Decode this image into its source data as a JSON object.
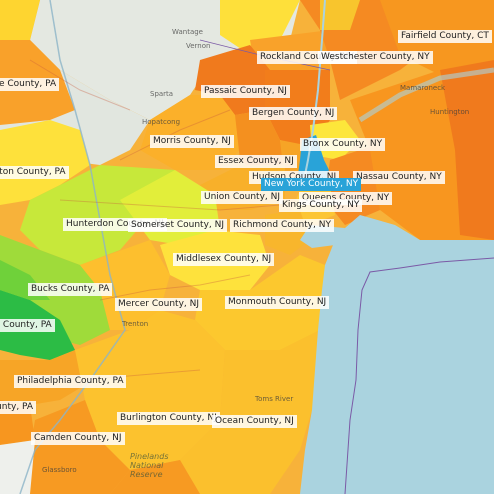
{
  "map": {
    "colors": {
      "water": "#aad3df",
      "land": "#e9ebe7",
      "selected": "#29a3d8",
      "scale": [
        "#1fb84a",
        "#6fd13a",
        "#bde83a",
        "#fffb3c",
        "#fdd12e",
        "#fcb52a",
        "#f79a22",
        "#f27a1e",
        "#ee5a18"
      ]
    },
    "counties": [
      {
        "label": "Fairfield County, CT"
      },
      {
        "label": "Rockland County, NY"
      },
      {
        "label": "Westchester County, NY"
      },
      {
        "label": "Monroe County, PA"
      },
      {
        "label": "Passaic County, NJ"
      },
      {
        "label": "Bergen County, NJ"
      },
      {
        "label": "Morris County, NJ"
      },
      {
        "label": "Bronx County, NY"
      },
      {
        "label": "Essex County, NJ"
      },
      {
        "label": "Northampton County, PA"
      },
      {
        "label": "Hudson County, NJ"
      },
      {
        "label": "Nassau County, NY"
      },
      {
        "label": "New York County, NY",
        "selected": true
      },
      {
        "label": "Union County, NJ"
      },
      {
        "label": "Queens County, NY"
      },
      {
        "label": "Kings County, NY"
      },
      {
        "label": "Hunterdon County, NJ"
      },
      {
        "label": "Somerset County, NJ"
      },
      {
        "label": "Richmond County, NY"
      },
      {
        "label": "Middlesex County, NJ"
      },
      {
        "label": "Bucks County, PA"
      },
      {
        "label": "Mercer County, NJ"
      },
      {
        "label": "Monmouth County, NJ"
      },
      {
        "label": "Montgomery County, PA"
      },
      {
        "label": "Philadelphia County, PA"
      },
      {
        "label": "Delaware County, PA"
      },
      {
        "label": "Burlington County, NJ"
      },
      {
        "label": "Ocean County, NJ"
      },
      {
        "label": "Camden County, NJ"
      }
    ],
    "places": [
      {
        "name": "Wantage"
      },
      {
        "name": "Vernon"
      },
      {
        "name": "Sparta"
      },
      {
        "name": "Hopatcong"
      },
      {
        "name": "Mamaroneck"
      },
      {
        "name": "Huntington"
      },
      {
        "name": "Trenton"
      },
      {
        "name": "Toms River"
      },
      {
        "name": "Glassboro"
      },
      {
        "name": "Pinelands National Reserve"
      }
    ]
  }
}
